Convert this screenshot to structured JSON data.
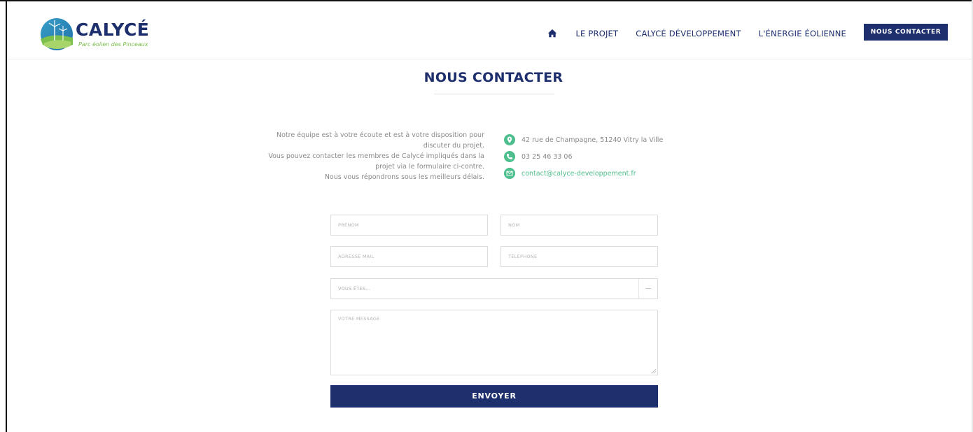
{
  "brand": {
    "name": "CALYCÉ",
    "tagline": "Parc éolien des Pinceaux",
    "colors": {
      "primary": "#1e2f6e",
      "accent": "#4ebe8d",
      "leaf": "#7bbf4c"
    }
  },
  "nav": {
    "home_icon": "home-icon",
    "items": [
      {
        "label": "LE PROJET"
      },
      {
        "label": "CALYCÉ DÉVELOPPEMENT"
      },
      {
        "label": "L'ÉNERGIE ÉOLIENNE"
      }
    ],
    "cta_label": "NOUS CONTACTER"
  },
  "page": {
    "title": "NOUS CONTACTER"
  },
  "intro": {
    "lines": [
      "Notre équipe est à votre écoute et est à votre disposition pour",
      "discuter du projet.",
      "Vous pouvez contacter les membres de Calycé impliqués dans la",
      "projet via le formulaire ci-contre.",
      "Nous vous répondrons sous les meilleurs délais."
    ]
  },
  "contact": {
    "address": "42 rue de Champagne, 51240 Vitry la Ville",
    "phone": "03 25 46 33 06",
    "email": "contact@calyce-developpement.fr",
    "icons": [
      "map-pin-icon",
      "phone-icon",
      "mail-icon"
    ]
  },
  "form": {
    "prenom_placeholder": "PRÉNOM",
    "nom_placeholder": "NOM",
    "email_placeholder": "ADRESSE MAIL",
    "tel_placeholder": "TÉLÉPHONE",
    "select_value": "VOUS ÊTES...",
    "message_placeholder": "VOTRE MESSAGE",
    "submit_label": "ENVOYER"
  }
}
